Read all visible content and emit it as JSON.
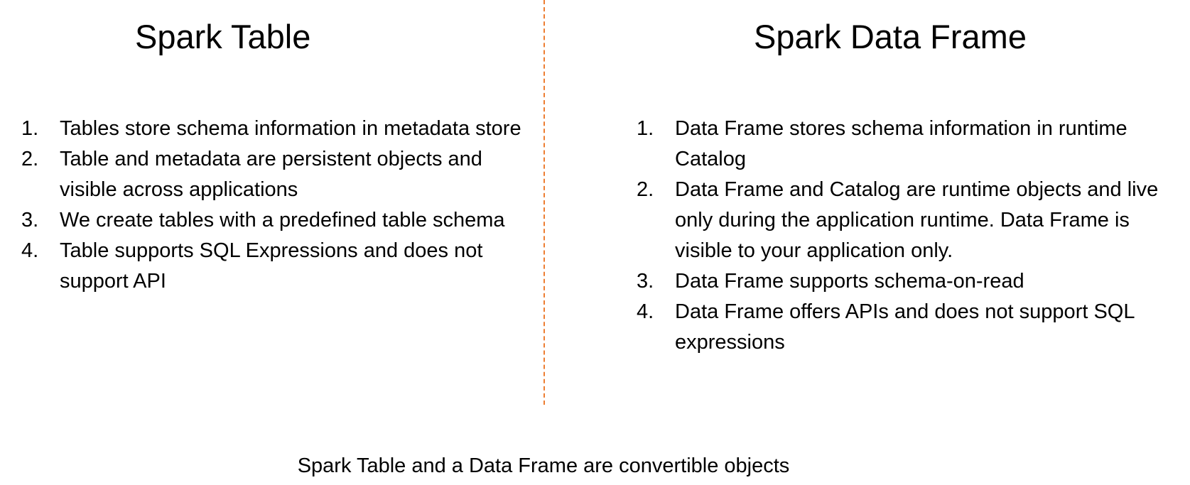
{
  "left": {
    "title": "Spark Table",
    "points": [
      {
        "num": "1.",
        "text": "Tables store schema information in metadata store"
      },
      {
        "num": "2.",
        "text": "Table and metadata are persistent objects and visible across applications"
      },
      {
        "num": "3.",
        "text": "We create tables with a predefined table schema"
      },
      {
        "num": "4.",
        "text": "Table supports SQL Expressions and does not support API"
      }
    ]
  },
  "right": {
    "title": "Spark Data Frame",
    "points": [
      {
        "num": "1.",
        "text": "Data Frame stores schema information in runtime Catalog"
      },
      {
        "num": "2.",
        "text": "Data Frame and Catalog are runtime objects and live only during the application runtime. Data Frame is visible to your application only."
      },
      {
        "num": "3.",
        "text": "Data Frame supports schema-on-read"
      },
      {
        "num": "4.",
        "text": "Data Frame offers APIs and does not support SQL expressions"
      }
    ]
  },
  "footer": "Spark Table and a Data Frame are convertible objects",
  "colors": {
    "divider": "#ed7d31",
    "text": "#000000",
    "background": "#ffffff"
  }
}
